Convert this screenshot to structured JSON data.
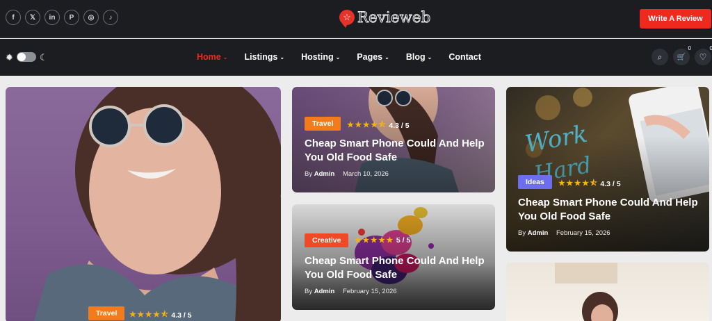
{
  "header": {
    "socials": [
      {
        "icon": "facebook-icon",
        "glyph": "f"
      },
      {
        "icon": "x-icon",
        "glyph": "𝕏"
      },
      {
        "icon": "linkedin-icon",
        "glyph": "in"
      },
      {
        "icon": "pinterest-icon",
        "glyph": "P"
      },
      {
        "icon": "instagram-icon",
        "glyph": "◎"
      },
      {
        "icon": "tiktok-icon",
        "glyph": "♪"
      }
    ],
    "logo_text": "Revieweb",
    "logo_glyph": "☆",
    "write_review_label": "Write A Review",
    "accent_color": "#ee2a1f"
  },
  "nav": {
    "items": [
      {
        "label": "Home",
        "has_dropdown": true,
        "active": true
      },
      {
        "label": "Listings",
        "has_dropdown": true
      },
      {
        "label": "Hosting",
        "has_dropdown": true
      },
      {
        "label": "Pages",
        "has_dropdown": true
      },
      {
        "label": "Blog",
        "has_dropdown": true
      },
      {
        "label": "Contact",
        "has_dropdown": false
      }
    ],
    "caret": "⌄",
    "sun_glyph": "✹",
    "moon_glyph": "☾",
    "search_glyph": "⌕",
    "cart_glyph": "🛒",
    "cart_count": "0",
    "wishlist_glyph": "♡",
    "wishlist_count": "0"
  },
  "cards": [
    {
      "category": "Travel",
      "category_color": "#f27b1d",
      "stars": "★★★★⯪",
      "rating": "4.3 / 5"
    },
    {
      "category": "Travel",
      "category_color": "#f27b1d",
      "stars": "★★★★⯪",
      "rating": "4.3 / 5",
      "title": "Cheap Smart Phone Could And Help You Old Food Safe",
      "author_prefix": "By",
      "author": "Admin",
      "date": "March 10, 2026"
    },
    {
      "category": "Ideas",
      "category_color": "#6d6df0",
      "stars": "★★★★⯪",
      "rating": "4.3 / 5",
      "title": "Cheap Smart Phone Could And Help You Old Food Safe",
      "author_prefix": "By",
      "author": "Admin",
      "date": "February 15, 2026"
    },
    {
      "category": "Creative",
      "category_color": "#ee4a25",
      "stars": "★★★★★",
      "rating": "5 / 5",
      "title": "Cheap Smart Phone Could And Help You Old Food Safe",
      "author_prefix": "By",
      "author": "Admin",
      "date": "February 15, 2026"
    }
  ]
}
